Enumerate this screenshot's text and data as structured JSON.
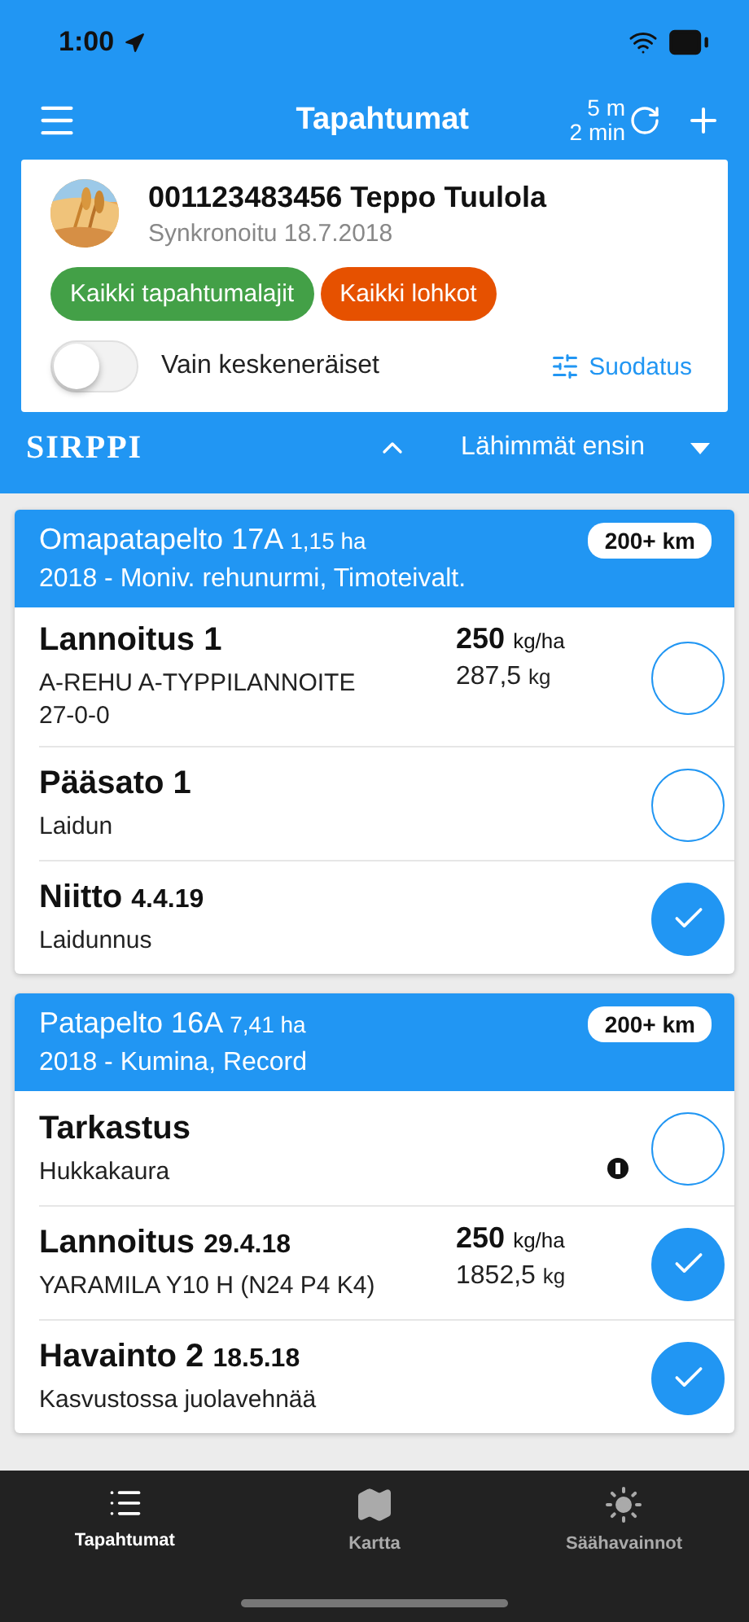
{
  "status_bar": {
    "time": "1:00"
  },
  "header": {
    "title": "Tapahtumat",
    "sync_lines": [
      "5 m",
      "2 min"
    ]
  },
  "profile": {
    "name": "001123483456 Teppo Tuulola",
    "synced": "Synkronoitu 18.7.2018",
    "chips": [
      {
        "label": "Kaikki tapahtumalajit",
        "color": "#43a047"
      },
      {
        "label": "Kaikki lohkot",
        "color": "#e65100"
      }
    ],
    "toggle": {
      "label": "Vain keskeneräiset",
      "on": false
    },
    "filter": "Suodatus"
  },
  "sort_bar": {
    "logo": "SIRPPI",
    "sort": "Lähimmät ensin"
  },
  "groups": [
    {
      "name": "Omapatapelto 17A",
      "area": "1,15 ha",
      "crop": "2018 - Moniv. rehunurmi, Timoteivalt.",
      "distance": "200+ km",
      "events": [
        {
          "title": "Lannoitus 1",
          "amount": "250",
          "amount_unit": "kg/ha",
          "detail": "A-REHU A-TYPPILANNOITE 27-0-0",
          "total": "287,5",
          "total_unit": "kg",
          "info": false,
          "done": false
        },
        {
          "title": "Pääsato 1",
          "detail": "Laidun",
          "info": false,
          "done": false
        },
        {
          "title": "Niitto",
          "date": "4.4.19",
          "detail": "Laidunnus",
          "info": false,
          "done": true
        }
      ]
    },
    {
      "name": "Patapelto 16A",
      "area": "7,41 ha",
      "crop": "2018 - Kumina, Record",
      "distance": "200+ km",
      "events": [
        {
          "title": "Tarkastus",
          "detail": "Hukkakaura",
          "info": true,
          "done": false
        },
        {
          "title": "Lannoitus",
          "date": "29.4.18",
          "amount": "250",
          "amount_unit": "kg/ha",
          "detail": "YARAMILA Y10 H (N24 P4 K4)",
          "total": "1852,5",
          "total_unit": "kg",
          "info": false,
          "done": true
        },
        {
          "title": "Havainto 2",
          "date": "18.5.18",
          "detail": "Kasvustossa juolavehnää",
          "info": false,
          "done": true
        }
      ]
    }
  ],
  "tabs": [
    {
      "label": "Tapahtumat",
      "selected": true
    },
    {
      "label": "Kartta",
      "selected": false
    },
    {
      "label": "Säähavainnot",
      "selected": false
    }
  ]
}
